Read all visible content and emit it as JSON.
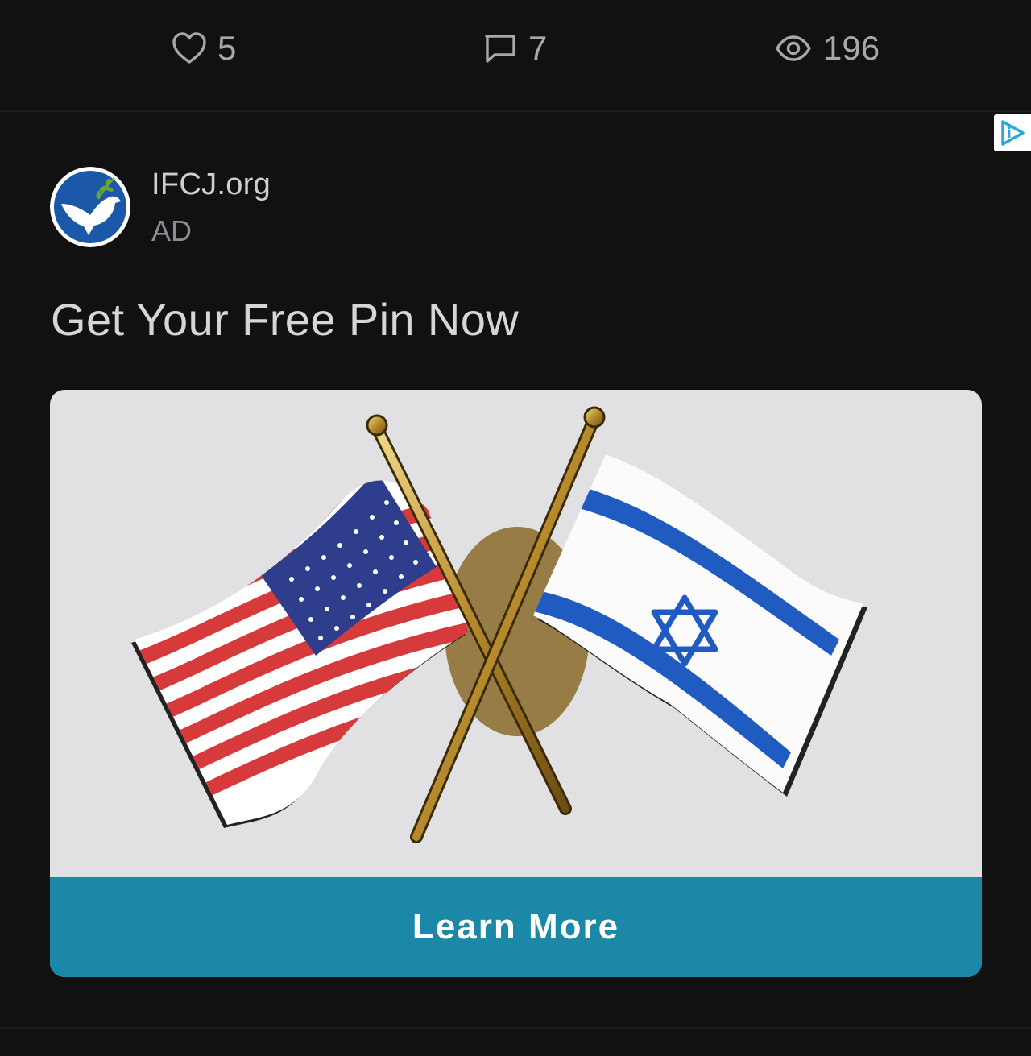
{
  "stats": {
    "likes": {
      "icon": "heart-icon",
      "count": "5"
    },
    "comments": {
      "icon": "comment-icon",
      "count": "7"
    },
    "views": {
      "icon": "eye-icon",
      "count": "196"
    }
  },
  "ad": {
    "advertiser": "IFCJ.org",
    "label": "AD",
    "headline": "Get Your Free Pin Now",
    "image_icon": "us-israel-flag-pin",
    "cta_label": "Learn More",
    "ad_choices_icon": "adchoices-icon",
    "logo_icon": "dove-logo-icon"
  },
  "colors": {
    "background": "#111112",
    "cta": "#1a88a6",
    "logo_blue": "#1b59a8",
    "israel_blue": "#1f5bc0"
  }
}
